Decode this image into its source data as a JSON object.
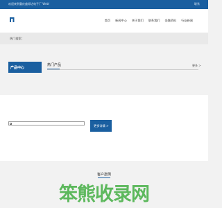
{
  "topbar": {
    "welcome": "欢迎来到重庆盛邦达电子厂 Web!",
    "contact": "联系"
  },
  "nav": {
    "items": [
      "首页",
      "新闻中心",
      "关于我们",
      "联系我们",
      "金融资料",
      "行业新闻"
    ]
  },
  "breadcrumb": "热门搜索：",
  "sidebar": {
    "title": "产品中心"
  },
  "products": {
    "section_title": "热门产品",
    "more": "更多 >"
  },
  "detail": {
    "button": "更多详情 >"
  },
  "cases": {
    "title": "客户案例"
  },
  "watermark": "笨熊收录网",
  "colors": {
    "primary": "#1a5fa0",
    "watermark": "#5cb85c"
  }
}
